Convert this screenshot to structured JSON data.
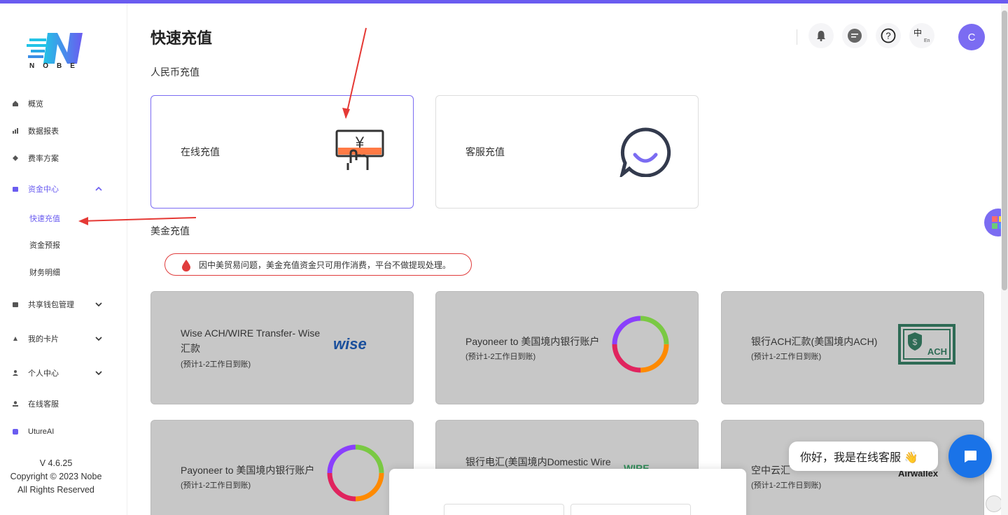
{
  "brand": {
    "name": "NOBE"
  },
  "sidebar": {
    "items": [
      {
        "label": "概览"
      },
      {
        "label": "数据报表"
      },
      {
        "label": "费率方案"
      },
      {
        "label": "资金中心"
      },
      {
        "label": "共享钱包管理"
      },
      {
        "label": "我的卡片"
      },
      {
        "label": "个人中心"
      },
      {
        "label": "在线客服"
      },
      {
        "label": "UtureAI"
      }
    ],
    "sub_items": [
      {
        "label": "快速充值"
      },
      {
        "label": "资金预报"
      },
      {
        "label": "财务明细"
      }
    ],
    "version": "V 4.6.25",
    "copyright": "Copyright © 2023 Nobe",
    "rights": "All Rights Reserved"
  },
  "header": {
    "lang_zh": "中",
    "lang_en": "En",
    "avatar_letter": "C"
  },
  "main": {
    "title": "快速充值",
    "rmb_section": "人民币充值",
    "rmb_cards": [
      {
        "title": "在线充值"
      },
      {
        "title": "客服充值"
      }
    ],
    "usd_section": "美金充值",
    "notice": "因中美贸易问题，美金充值资金只可用作消费，平台不做提现处理。",
    "usd_cards": [
      {
        "title_line1": "Wise ACH/WIRE Transfer- Wise",
        "title_line2": "汇款",
        "sub": "(预计1-2工作日到账)",
        "logo": "wise"
      },
      {
        "title_line1": "Payoneer to 美国境内银行账户",
        "sub": "(预计1-2工作日到账)"
      },
      {
        "title_line1": "银行ACH汇款(美国境内ACH)",
        "sub": "(预计1-2工作日到账)",
        "logo": "ACH"
      },
      {
        "title_line1": "Payoneer to 美国境内银行账户",
        "sub": "(预计1-2工作日到账)"
      },
      {
        "title_line1": "银行电汇(美国境内Domestic Wire",
        "logo": "WIRE"
      },
      {
        "title_line1": "空中云汇",
        "sub": "(预计1-2工作日到账)",
        "logo": "Airwallex"
      }
    ]
  },
  "chat": {
    "greeting": "你好，我是在线客服 👋"
  },
  "colors": {
    "accent": "#6a5cf0",
    "danger": "#e03c3c",
    "gray_card": "#c7c7c7",
    "chat_blue": "#1a73e8"
  }
}
